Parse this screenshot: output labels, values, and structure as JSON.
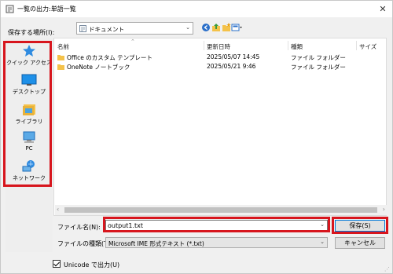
{
  "window": {
    "title": "一覧の出力:単語一覧",
    "close_symbol": "✕"
  },
  "location": {
    "label": "保存する場所(I):",
    "value": "ドキュメント"
  },
  "places": [
    {
      "label": "クイック アクセス",
      "icon": "star-icon"
    },
    {
      "label": "デスクトップ",
      "icon": "desktop-icon"
    },
    {
      "label": "ライブラリ",
      "icon": "library-icon"
    },
    {
      "label": "PC",
      "icon": "pc-icon"
    },
    {
      "label": "ネットワーク",
      "icon": "network-icon"
    }
  ],
  "filelist": {
    "columns": [
      "名前",
      "更新日時",
      "種類",
      "サイズ"
    ],
    "rows": [
      {
        "name": "Office のカスタム テンプレート",
        "modified": "2025/05/07 14:45",
        "type": "ファイル フォルダー",
        "size": ""
      },
      {
        "name": "OneNote ノートブック",
        "modified": "2025/05/21 9:46",
        "type": "ファイル フォルダー",
        "size": ""
      }
    ]
  },
  "filename": {
    "label": "ファイル名(N):",
    "value": "output1.txt"
  },
  "filetype": {
    "label": "ファイルの種類(T):",
    "value": "Microsoft IME 形式テキスト (*.txt)"
  },
  "buttons": {
    "save": "保存(S)",
    "cancel": "キャンセル"
  },
  "unicode_option": {
    "label": "Unicode で出力(U)",
    "checked": true
  },
  "colors": {
    "highlight": "#d7151d",
    "accent": "#0078d7",
    "folder": "#f4c24a"
  }
}
